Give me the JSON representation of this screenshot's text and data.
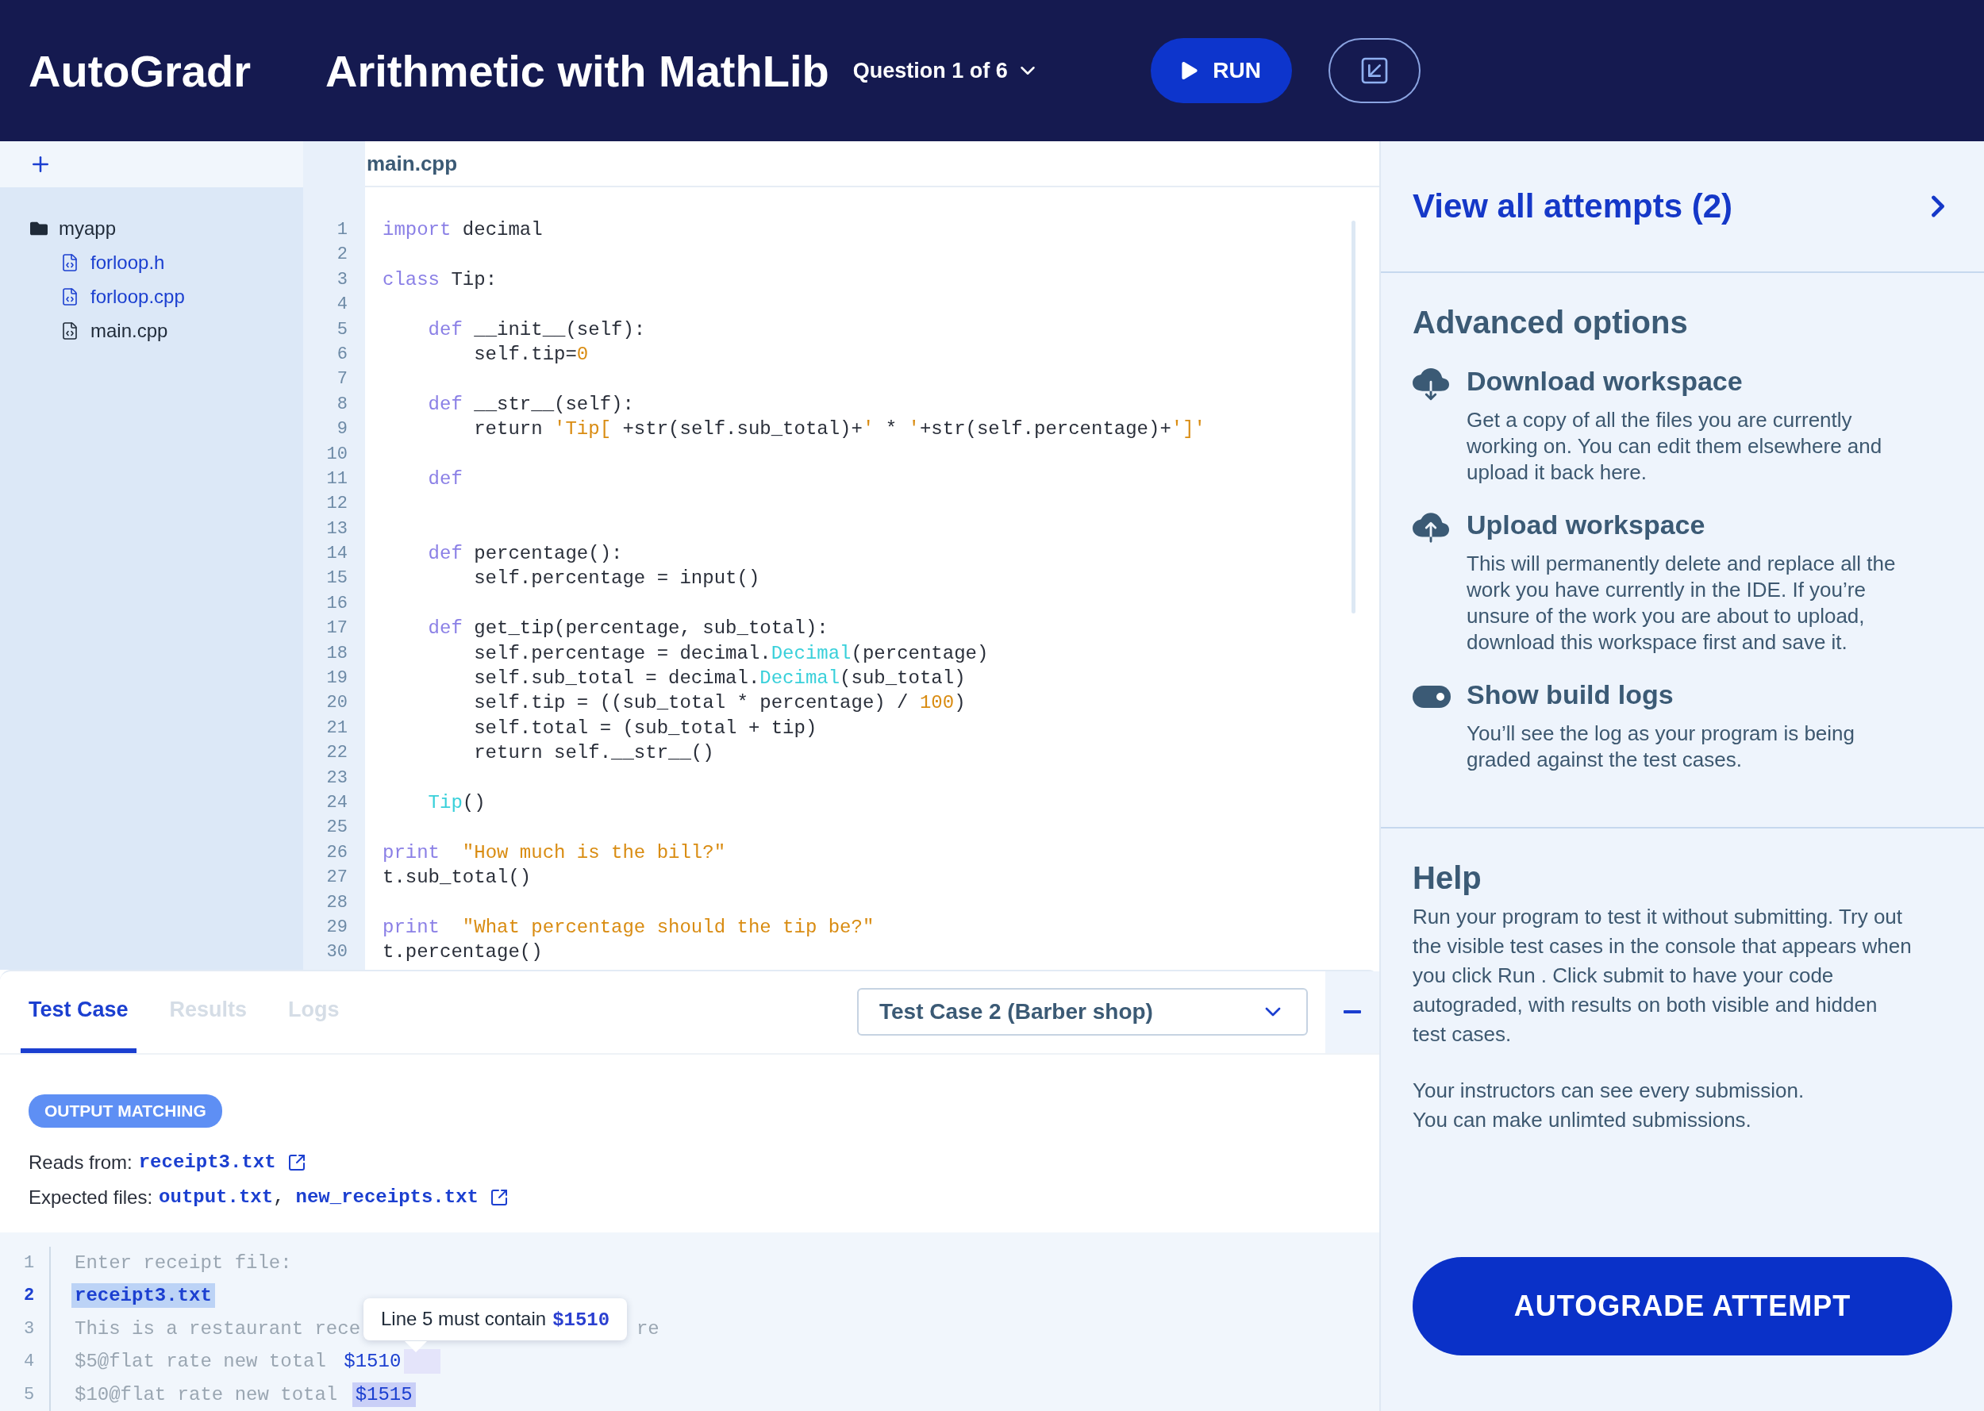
{
  "header": {
    "logo": "AutoGradr",
    "title": "Arithmetic with MathLib",
    "question": "Question 1 of 6",
    "run_label": "RUN"
  },
  "sidebar": {
    "tree": [
      {
        "kind": "folder",
        "name": "myapp",
        "children": [
          {
            "kind": "file",
            "name": "forloop.h",
            "color": "#1b3fd0"
          },
          {
            "kind": "file",
            "name": "forloop.cpp",
            "color": "#1b3fd0"
          },
          {
            "kind": "file",
            "name": "main.cpp",
            "color": "#1f2a38"
          }
        ]
      }
    ]
  },
  "editor": {
    "tab": "main.cpp",
    "lines": [
      {
        "number": "1",
        "tokens": [
          {
            "kind": "keyword",
            "text": "import"
          },
          {
            "kind": "plain",
            "text": " decimal"
          }
        ]
      },
      {
        "number": "2"
      },
      {
        "number": "3",
        "tokens": [
          {
            "kind": "keyword",
            "text": "class"
          },
          {
            "kind": "plain",
            "text": " Tip:"
          }
        ]
      },
      {
        "number": "4"
      },
      {
        "number": "5",
        "tokens": [
          {
            "kind": "keyword",
            "text": "    def"
          },
          {
            "kind": "plain",
            "text": " __init__(self):"
          }
        ]
      },
      {
        "number": "6",
        "tokens": [
          {
            "kind": "plain",
            "text": "        self.tip="
          },
          {
            "kind": "number",
            "text": "0"
          }
        ]
      },
      {
        "number": "7"
      },
      {
        "number": "8",
        "tokens": [
          {
            "kind": "keyword",
            "text": "    def"
          },
          {
            "kind": "plain",
            "text": " __str__(self):"
          }
        ]
      },
      {
        "number": "9",
        "tokens": [
          {
            "kind": "plain",
            "text": "        return "
          },
          {
            "kind": "string",
            "text": "'Tip[ "
          },
          {
            "kind": "plain",
            "text": "+str(self.sub_total)+"
          },
          {
            "kind": "string",
            "text": "'"
          },
          {
            "kind": "plain",
            "text": " * "
          },
          {
            "kind": "string",
            "text": "'"
          },
          {
            "kind": "plain",
            "text": "+str(self.percentage)+"
          },
          {
            "kind": "string",
            "text": "']'"
          }
        ]
      },
      {
        "number": "10"
      },
      {
        "number": "11",
        "tokens": [
          {
            "kind": "keyword",
            "text": "    def"
          }
        ]
      },
      {
        "number": "12"
      },
      {
        "number": "13"
      },
      {
        "number": "14",
        "tokens": [
          {
            "kind": "keyword",
            "text": "    def"
          },
          {
            "kind": "plain",
            "text": " percentage():"
          }
        ]
      },
      {
        "number": "15",
        "tokens": [
          {
            "kind": "plain",
            "text": "        self.percentage = input()"
          }
        ]
      },
      {
        "number": "16"
      },
      {
        "number": "17",
        "tokens": [
          {
            "kind": "keyword",
            "text": "    def"
          },
          {
            "kind": "plain",
            "text": " get_tip(percentage, sub_total):"
          }
        ]
      },
      {
        "number": "18",
        "tokens": [
          {
            "kind": "plain",
            "text": "        self.percentage = decimal."
          },
          {
            "kind": "call",
            "text": "Decimal"
          },
          {
            "kind": "plain",
            "text": "(percentage)"
          }
        ]
      },
      {
        "number": "19",
        "tokens": [
          {
            "kind": "plain",
            "text": "        self.sub_total = decimal."
          },
          {
            "kind": "call",
            "text": "Decimal"
          },
          {
            "kind": "plain",
            "text": "(sub_total)"
          }
        ]
      },
      {
        "number": "20",
        "tokens": [
          {
            "kind": "plain",
            "text": "        self.tip = ((sub_total * percentage) / "
          },
          {
            "kind": "number",
            "text": "100"
          },
          {
            "kind": "plain",
            "text": ")"
          }
        ]
      },
      {
        "number": "21",
        "tokens": [
          {
            "kind": "plain",
            "text": "        self.total = (sub_total + tip)"
          }
        ]
      },
      {
        "number": "22",
        "tokens": [
          {
            "kind": "plain",
            "text": "        return self.__str__()"
          }
        ]
      },
      {
        "number": "23"
      },
      {
        "number": "24",
        "tokens": [
          {
            "kind": "call",
            "text": "    Tip"
          },
          {
            "kind": "plain",
            "text": "()"
          }
        ]
      },
      {
        "number": "25"
      },
      {
        "number": "26",
        "tokens": [
          {
            "kind": "keyword",
            "text": "print"
          },
          {
            "kind": "string",
            "text": "  \"How much is the bill?\""
          }
        ]
      },
      {
        "number": "27",
        "tokens": [
          {
            "kind": "plain",
            "text": "t.sub_total()"
          }
        ]
      },
      {
        "number": "28"
      },
      {
        "number": "29",
        "tokens": [
          {
            "kind": "keyword",
            "text": "print"
          },
          {
            "kind": "string",
            "text": "  \"What percentage should the tip be?\""
          }
        ]
      },
      {
        "number": "30",
        "tokens": [
          {
            "kind": "plain",
            "text": "t.percentage()"
          }
        ]
      }
    ]
  },
  "test_panel": {
    "tabs": [
      {
        "label": "Test Case",
        "selected": true
      },
      {
        "label": "Results",
        "selected": false
      },
      {
        "label": "Logs",
        "selected": false
      }
    ],
    "case_select": "Test Case 2 (Barber shop)",
    "badge": "OUTPUT MATCHING",
    "reads_from": {
      "label": "Reads from:",
      "files": [
        "receipt3.txt"
      ]
    },
    "expected_files": {
      "label": "Expected files:",
      "separator": ",",
      "files": [
        "output.txt",
        "new_receipts.txt"
      ]
    },
    "console": [
      {
        "number": "1",
        "active": false,
        "segments": [
          {
            "kind": "plain",
            "text": "Enter receipt file:"
          }
        ]
      },
      {
        "number": "2",
        "active": true,
        "segments": [
          {
            "kind": "input",
            "text": "receipt3.txt"
          }
        ]
      },
      {
        "number": "3",
        "active": false,
        "segments": [
          {
            "kind": "plain",
            "text": "This is a restaurant rece"
          },
          {
            "kind": "hidden"
          },
          {
            "kind": "plain",
            "text": "re"
          }
        ]
      },
      {
        "number": "4",
        "active": false,
        "segments": [
          {
            "kind": "plain",
            "text": "$5@flat rate new total "
          },
          {
            "kind": "expected",
            "text": "$1510"
          },
          {
            "kind": "gap"
          }
        ]
      },
      {
        "number": "5",
        "active": false,
        "segments": [
          {
            "kind": "plain",
            "text": "$10@flat rate new total "
          },
          {
            "kind": "mismatch",
            "text": "$1515"
          }
        ]
      }
    ],
    "tooltip": {
      "text": "Line 5 must contain",
      "value": "$1510"
    }
  },
  "right_panel": {
    "attempts_link": "View all attempts (2)",
    "advanced_title": "Advanced options",
    "options": [
      {
        "kind": "download",
        "title": "Download workspace",
        "description": "Get a copy of all the files you are currently working on. You can edit them elsewhere and upload it back here."
      },
      {
        "kind": "upload",
        "title": "Upload workspace",
        "description": "This will permanently delete and replace all the work you have currently in the IDE. If you’re unsure of the work you are about to upload, download this workspace first and save it."
      },
      {
        "kind": "toggle",
        "on": true,
        "title": "Show build logs",
        "description": "You’ll see the log as your program is being graded against the test cases."
      }
    ],
    "help_title": "Help",
    "help_paragraphs": [
      "Run your program to test it without submitting. Try out the visible test cases in the console that appears when you click Run . Click submit to have your code autograded, with results on both visible and hidden test cases.",
      "Your instructors can see every submission.\nYou can make unlimted submissions."
    ],
    "autograde_label": "AUTOGRADE ATTEMPT"
  }
}
